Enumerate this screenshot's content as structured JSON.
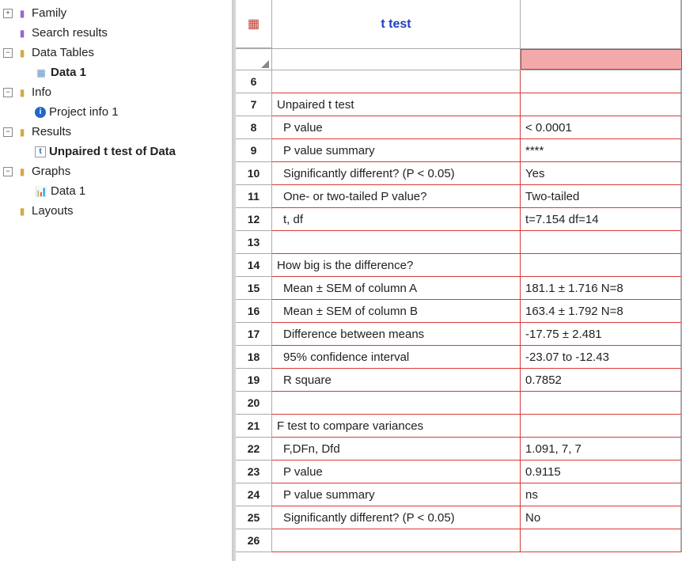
{
  "tree": {
    "family": "Family",
    "search_results": "Search results",
    "data_tables": "Data Tables",
    "data1": "Data 1",
    "info": "Info",
    "project_info": "Project info 1",
    "results": "Results",
    "unpaired": "Unpaired t test of Data",
    "graphs": "Graphs",
    "graphs_data1": "Data 1",
    "layouts": "Layouts"
  },
  "sheet": {
    "title": "t test"
  },
  "rows": [
    {
      "n": "6",
      "a": "",
      "b": "",
      "indent": false,
      "head": false
    },
    {
      "n": "7",
      "a": "Unpaired t test",
      "b": "",
      "indent": false,
      "head": true
    },
    {
      "n": "8",
      "a": "P value",
      "b": "< 0.0001",
      "indent": true,
      "head": false
    },
    {
      "n": "9",
      "a": "P value summary",
      "b": "****",
      "indent": true,
      "head": false
    },
    {
      "n": "10",
      "a": "Significantly different? (P < 0.05)",
      "b": "Yes",
      "indent": true,
      "head": false
    },
    {
      "n": "11",
      "a": "One- or two-tailed P value?",
      "b": "Two-tailed",
      "indent": true,
      "head": false
    },
    {
      "n": "12",
      "a": "t, df",
      "b": "t=7.154 df=14",
      "indent": true,
      "head": false
    },
    {
      "n": "13",
      "a": "",
      "b": "",
      "indent": false,
      "head": false
    },
    {
      "n": "14",
      "a": "How big is the difference?",
      "b": "",
      "indent": false,
      "head": true
    },
    {
      "n": "15",
      "a": "Mean ± SEM of column A",
      "b": "181.1 ± 1.716 N=8",
      "indent": true,
      "head": false
    },
    {
      "n": "16",
      "a": "Mean ± SEM of column B",
      "b": "163.4 ± 1.792 N=8",
      "indent": true,
      "head": false
    },
    {
      "n": "17",
      "a": "Difference between means",
      "b": "-17.75 ± 2.481",
      "indent": true,
      "head": false
    },
    {
      "n": "18",
      "a": "95% confidence interval",
      "b": "-23.07 to -12.43",
      "indent": true,
      "head": false
    },
    {
      "n": "19",
      "a": "R square",
      "b": "0.7852",
      "indent": true,
      "head": false
    },
    {
      "n": "20",
      "a": "",
      "b": "",
      "indent": false,
      "head": false
    },
    {
      "n": "21",
      "a": "F test to compare variances",
      "b": "",
      "indent": false,
      "head": true
    },
    {
      "n": "22",
      "a": "F,DFn, Dfd",
      "b": "1.091, 7, 7",
      "indent": true,
      "head": false
    },
    {
      "n": "23",
      "a": "P value",
      "b": "0.9115",
      "indent": true,
      "head": false
    },
    {
      "n": "24",
      "a": "P value summary",
      "b": "ns",
      "indent": true,
      "head": false
    },
    {
      "n": "25",
      "a": "Significantly different? (P < 0.05)",
      "b": "No",
      "indent": true,
      "head": false
    },
    {
      "n": "26",
      "a": "",
      "b": "",
      "indent": false,
      "head": false
    }
  ]
}
